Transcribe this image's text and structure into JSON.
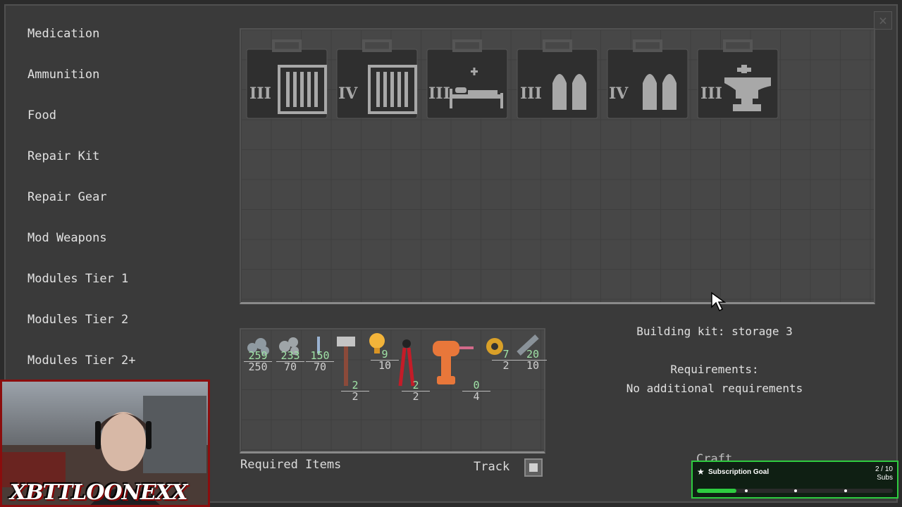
{
  "categories": [
    "Medication",
    "Ammunition",
    "Food",
    "Repair Kit",
    "Repair Gear",
    "Mod Weapons",
    "Modules Tier 1",
    "Modules Tier 2",
    "Modules Tier 2+"
  ],
  "close_icon": "×",
  "kits": [
    {
      "tier": "III",
      "icon": "storage-icon"
    },
    {
      "tier": "IV",
      "icon": "storage-icon"
    },
    {
      "tier": "III",
      "icon": "bed-icon"
    },
    {
      "tier": "III",
      "icon": "ammo-icon"
    },
    {
      "tier": "IV",
      "icon": "ammo-icon"
    },
    {
      "tier": "III",
      "icon": "anvil-icon"
    }
  ],
  "selected": {
    "title": "Building kit: storage 3",
    "requirements_label": "Requirements:",
    "requirements_value": "No additional requirements"
  },
  "required_items": [
    {
      "icon": "steel-pile-icon",
      "have": "259",
      "need": "250"
    },
    {
      "icon": "scrap-pile-icon",
      "have": "233",
      "need": "70"
    },
    {
      "icon": "wire-icon",
      "have": "150",
      "need": "70"
    },
    {
      "icon": "hammer-icon",
      "have": "2",
      "need": "2"
    },
    {
      "icon": "bulb-icon",
      "have": "9",
      "need": "10"
    },
    {
      "icon": "pliers-icon",
      "have": "2",
      "need": "2"
    },
    {
      "icon": "drill-icon",
      "have": "0",
      "need": "4"
    },
    {
      "icon": "tape-icon",
      "have": "7",
      "need": "2"
    },
    {
      "icon": "pipe-icon",
      "have": "20",
      "need": "10"
    }
  ],
  "labels": {
    "required_items": "Required Items",
    "track": "Track",
    "craft": "Craft"
  },
  "overlay": {
    "streamer": "XBTTLOONEXX",
    "subgoal_title": "Subscription Goal",
    "subgoal_count": "2 / 10",
    "subgoal_unit": "Subs",
    "subgoal_progress": 0.2
  }
}
